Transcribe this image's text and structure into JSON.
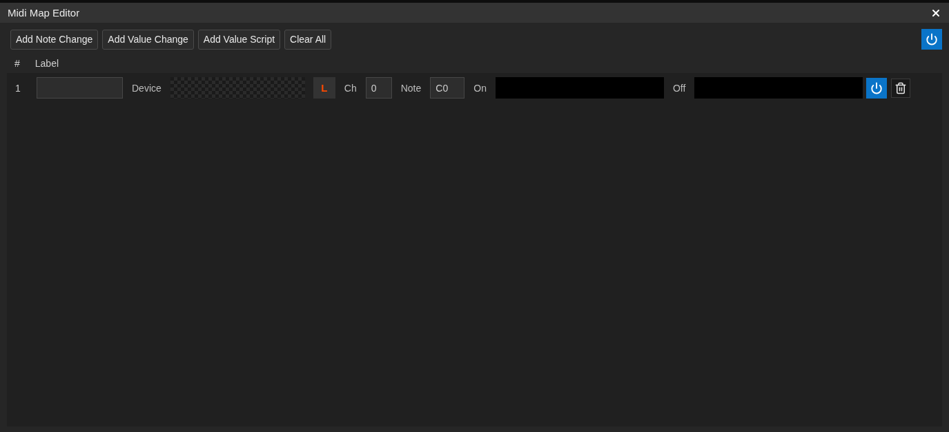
{
  "window": {
    "title": "Midi Map Editor"
  },
  "toolbar": {
    "buttons": [
      "Add Note Change",
      "Add Value Change",
      "Add Value Script",
      "Clear All"
    ],
    "power": {
      "on": true
    }
  },
  "table": {
    "columns": [
      "#",
      "Label"
    ],
    "rows": [
      {
        "index": "1",
        "device_label": "Device",
        "learn_button": "L",
        "channel_label": "Ch",
        "channel": "0",
        "note_label": "Note",
        "note": "C0",
        "on_label": "On",
        "off_label": "Off",
        "enabled": true
      }
    ]
  }
}
